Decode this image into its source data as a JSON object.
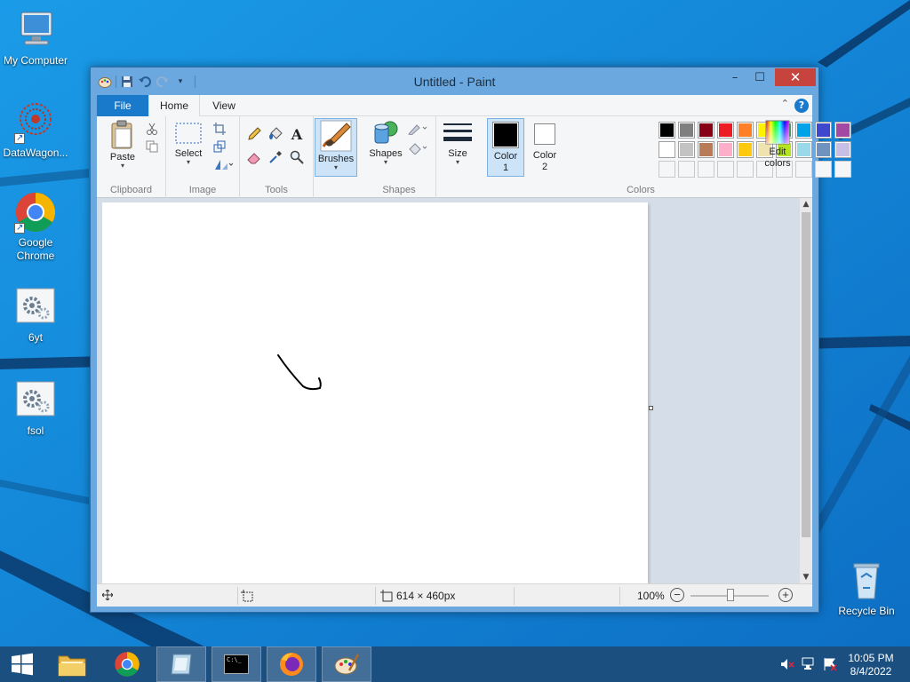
{
  "desktop": {
    "icons": [
      {
        "label": "My Computer",
        "icon": "computer-icon",
        "shortcut": false
      },
      {
        "label": "DataWagon...",
        "icon": "datawagon-icon",
        "shortcut": true
      },
      {
        "label": "Google Chrome",
        "icon": "chrome-icon",
        "shortcut": true
      },
      {
        "label": "6yt",
        "icon": "settings-file-icon",
        "shortcut": false
      },
      {
        "label": "fsol",
        "icon": "settings-file-icon",
        "shortcut": false
      },
      {
        "label": "Recycle Bin",
        "icon": "recycle-bin-icon",
        "shortcut": false
      }
    ]
  },
  "window": {
    "title": "Untitled - Paint",
    "controls": {
      "minimize": "–",
      "maximize": "☐",
      "close": "✕"
    }
  },
  "ribbon": {
    "tabs": {
      "file": "File",
      "home": "Home",
      "view": "View"
    },
    "help": "?",
    "groups": {
      "clipboard": {
        "label": "Clipboard",
        "paste": "Paste"
      },
      "image": {
        "label": "Image",
        "select": "Select"
      },
      "tools": {
        "label": "Tools"
      },
      "brushes": {
        "label": "Brushes"
      },
      "shapes": {
        "label": "Shapes",
        "shapes_btn": "Shapes"
      },
      "size": {
        "label": "Size"
      },
      "colors": {
        "label": "Colors",
        "color1": "Color 1",
        "color1_num": "1",
        "color1_word": "Color",
        "color2_word": "Color",
        "color2_num": "2",
        "edit_colors_1": "Edit",
        "edit_colors_2": "colors"
      }
    },
    "palette_row1": [
      "#000000",
      "#7f7f7f",
      "#880015",
      "#ed1c24",
      "#ff7f27",
      "#fff200",
      "#22b14c",
      "#00a2e8",
      "#3f48cc",
      "#a349a4"
    ],
    "palette_row2": [
      "#ffffff",
      "#c3c3c3",
      "#b97a57",
      "#ffaec9",
      "#ffc90e",
      "#efe4b0",
      "#b5e61d",
      "#99d9ea",
      "#7092be",
      "#c8bfe7"
    ],
    "palette_row3_count": 10,
    "color1_value": "#000000",
    "color2_value": "#ffffff"
  },
  "statusbar": {
    "canvas_size": "614 × 460px",
    "zoom": "100%",
    "zoom_minus": "−",
    "zoom_plus": "+"
  },
  "taskbar": {
    "time": "10:05 PM",
    "date": "8/4/2022",
    "cmd_text": "C:\\_"
  }
}
